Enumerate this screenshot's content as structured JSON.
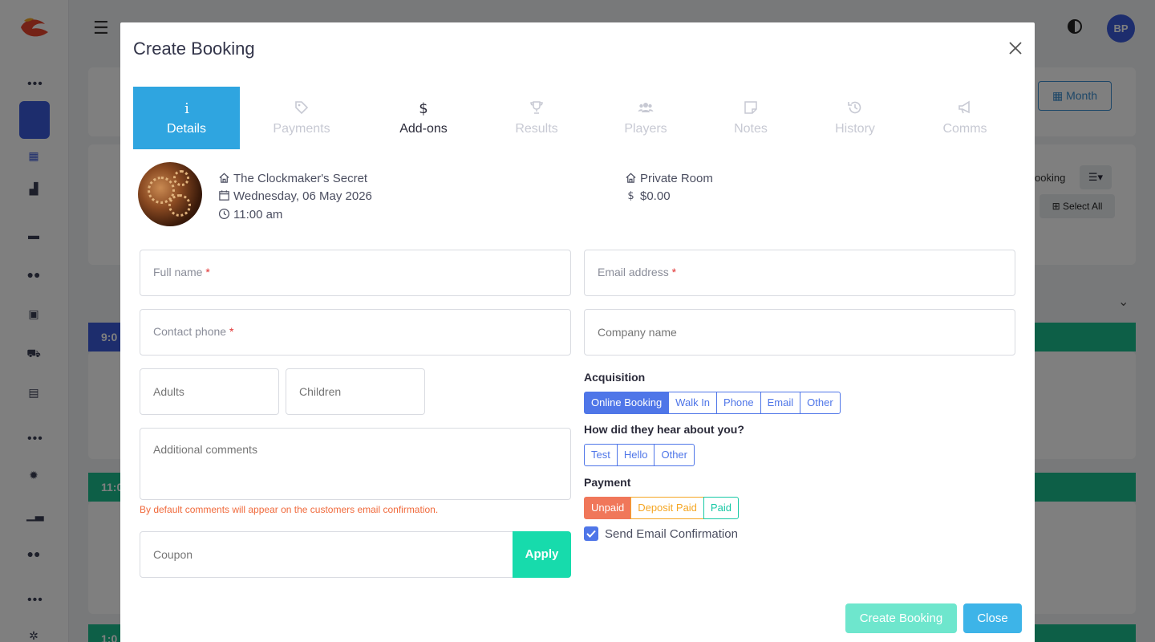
{
  "background": {
    "avatar_initials": "BP",
    "month_button": "Month",
    "select_all": "Select All",
    "booking_partial": "ooking",
    "bar_times": [
      "9:0",
      "11:0",
      "1:0"
    ]
  },
  "modal": {
    "title": "Create Booking",
    "tabs": [
      {
        "label": "Details",
        "icon": "info-icon"
      },
      {
        "label": "Payments",
        "icon": "tags-icon"
      },
      {
        "label": "Add-ons",
        "icon": "dollar-icon"
      },
      {
        "label": "Results",
        "icon": "trophy-icon"
      },
      {
        "label": "Players",
        "icon": "users-icon"
      },
      {
        "label": "Notes",
        "icon": "note-icon"
      },
      {
        "label": "History",
        "icon": "history-icon"
      },
      {
        "label": "Comms",
        "icon": "megaphone-icon"
      }
    ],
    "summary": {
      "experience": "The Clockmaker's Secret",
      "date": "Wednesday, 06 May 2026",
      "time": "11:00 am",
      "room": "Private Room",
      "price": "$0.00"
    },
    "form": {
      "full_name": "Full name",
      "email": "Email address",
      "phone": "Contact phone",
      "company": "Company name",
      "adults": "Adults",
      "children": "Children",
      "comments": "Additional comments",
      "comments_hint": "By default comments will appear on the customers email confirmation.",
      "coupon": "Coupon",
      "apply": "Apply",
      "required_mark": "*"
    },
    "acquisition": {
      "label": "Acquisition",
      "options": [
        "Online Booking",
        "Walk In",
        "Phone",
        "Email",
        "Other"
      ],
      "selected": "Online Booking"
    },
    "heard": {
      "label": "How did they hear about you?",
      "options": [
        "Test",
        "Hello",
        "Other"
      ]
    },
    "payment": {
      "label": "Payment",
      "options": [
        "Unpaid",
        "Deposit Paid",
        "Paid"
      ],
      "selected": "Unpaid",
      "colors": {
        "unpaid": "#f0775a",
        "deposit": "#f5a623",
        "paid": "#17c9a5"
      }
    },
    "send_email": {
      "label": "Send Email Confirmation",
      "checked": true
    },
    "buttons": {
      "create": "Create Booking",
      "close": "Close"
    }
  }
}
